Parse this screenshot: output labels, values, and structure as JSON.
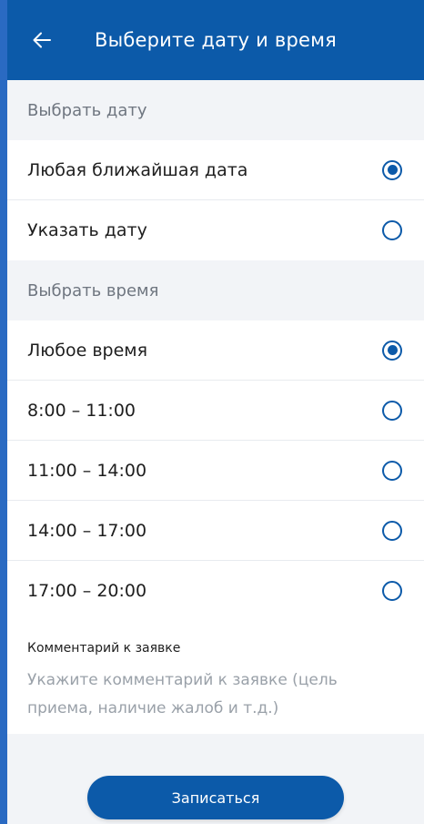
{
  "header": {
    "title": "Выберите дату и время",
    "back_icon": "arrow-left-icon"
  },
  "date_section": {
    "title": "Выбрать дату",
    "options": [
      {
        "label": "Любая ближайшая дата",
        "selected": true
      },
      {
        "label": "Указать дату",
        "selected": false
      }
    ]
  },
  "time_section": {
    "title": "Выбрать время",
    "options": [
      {
        "label": "Любое время",
        "selected": true
      },
      {
        "label": "8:00 – 11:00",
        "selected": false
      },
      {
        "label": "11:00 – 14:00",
        "selected": false
      },
      {
        "label": "14:00 – 17:00",
        "selected": false
      },
      {
        "label": "17:00 – 20:00",
        "selected": false
      }
    ]
  },
  "comment": {
    "label": "Комментарий к заявке",
    "placeholder": "Укажите комментарий к заявке (цель приема, наличие жалоб и т.д.)",
    "value": ""
  },
  "submit": {
    "label": "Записаться"
  },
  "colors": {
    "primary": "#0c5aa9",
    "background": "#f2f4f7",
    "muted_text": "#6f7680",
    "placeholder_text": "#9aa1a9"
  }
}
